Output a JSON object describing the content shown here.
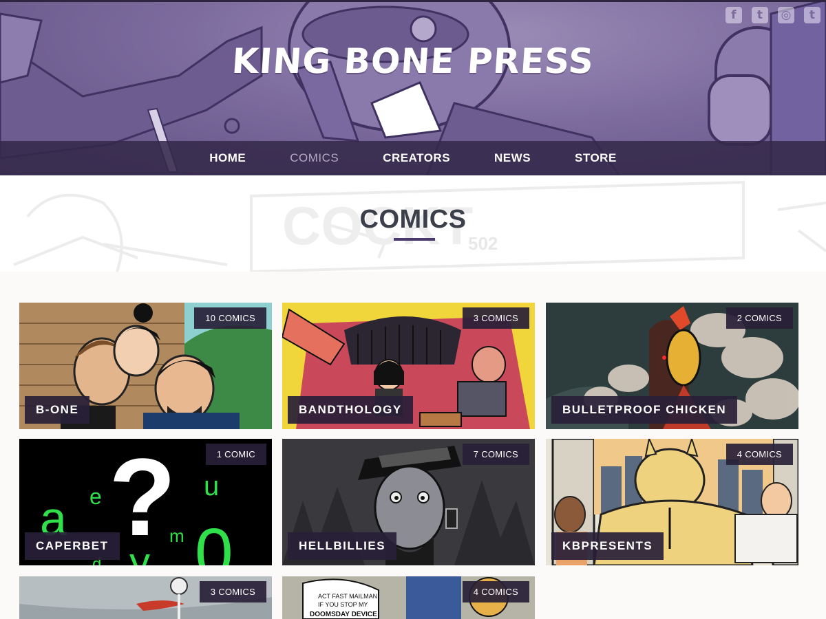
{
  "site": {
    "logo_text": "KING BONE PRESS"
  },
  "social": [
    {
      "icon": "facebook-icon",
      "glyph": "f"
    },
    {
      "icon": "twitter-icon",
      "glyph": "t"
    },
    {
      "icon": "instagram-icon",
      "glyph": "◎"
    },
    {
      "icon": "tumblr-icon",
      "glyph": "t"
    }
  ],
  "nav": {
    "items": [
      {
        "label": "HOME",
        "active": false
      },
      {
        "label": "COMICS",
        "active": true
      },
      {
        "label": "CREATORS",
        "active": false
      },
      {
        "label": "NEWS",
        "active": false
      },
      {
        "label": "STORE",
        "active": false
      }
    ]
  },
  "page": {
    "title": "COMICS",
    "banner_sign_text": "COCKT",
    "banner_sign_number": "502"
  },
  "comics": [
    {
      "name": "B-ONE",
      "count": "10 COMICS"
    },
    {
      "name": "BANDTHOLOGY",
      "count": "3 COMICS"
    },
    {
      "name": "BULLETPROOF CHICKEN",
      "count": "2 COMICS"
    },
    {
      "name": "CAPERBET",
      "count": "1 COMIC"
    },
    {
      "name": "HELLBILLIES",
      "count": "7 COMICS"
    },
    {
      "name": "KBPRESENTS",
      "count": "4 COMICS"
    },
    {
      "name": "",
      "count": "3 COMICS"
    },
    {
      "name": "",
      "count": "4 COMICS",
      "speech": [
        "ACT FAST MAILMAN!",
        "IF YOU STOP MY",
        "DOOMSDAY DEVICE"
      ]
    }
  ],
  "caperbet_letters": [
    "?",
    "a",
    "e",
    "u",
    "m",
    "y",
    "0",
    "d"
  ],
  "colors": {
    "accent": "#4a3b6c",
    "nav_bg": "#34294a",
    "header_purple": "#7d6b9e",
    "label_bg": "#28203a"
  }
}
